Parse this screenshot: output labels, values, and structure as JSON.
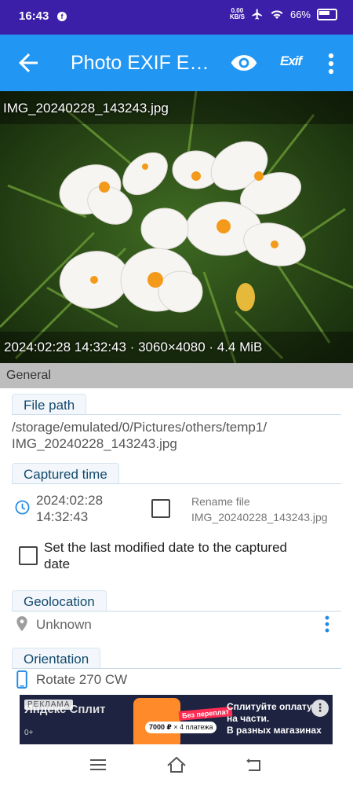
{
  "status_bar": {
    "time": "16:43",
    "notification_icon": "facebook-icon",
    "net_speed_value": "0.00",
    "net_speed_unit": "KB/S",
    "battery": "66%"
  },
  "app_bar": {
    "title": "Photo EXIF E…",
    "exif_label": "Exif"
  },
  "photo": {
    "filename": "IMG_20240228_143243.jpg",
    "info": "2024:02:28 14:32:43 · 3060×4080 · 4.4 MiB"
  },
  "general": {
    "header": "General",
    "file_path": {
      "label": "File path",
      "line1": "/storage/emulated/0/Pictures/others/temp1/",
      "line2": "IMG_20240228_143243.jpg"
    },
    "captured_time": {
      "label": "Captured time",
      "date": "2024:02:28",
      "time": "14:32:43",
      "rename_label": "Rename file",
      "rename_value": "IMG_20240228_143243.jpg",
      "set_last_modified_line1": "Set the last modified date to the captured",
      "set_last_modified_line2": "date"
    },
    "geolocation": {
      "label": "Geolocation",
      "value": "Unknown"
    },
    "orientation": {
      "label": "Orientation",
      "value": "Rotate 270 CW"
    }
  },
  "ad": {
    "badge": "РЕКЛАМА",
    "brand": "Яндекс Сплит",
    "age": "0+",
    "tag": "Без переплат",
    "pill_amount": "7000 ₽",
    "pill_suffix": "× 4 платежа",
    "headline_line1": "Сплитуйте оплату",
    "headline_line2": "на части.",
    "headline_line3": "В разных магазинах"
  },
  "colors": {
    "status_bar": "#3b1fa8",
    "app_bar": "#2196f3",
    "section_tab_text": "#134a6e",
    "section_header_bg": "#bdbdbd"
  }
}
